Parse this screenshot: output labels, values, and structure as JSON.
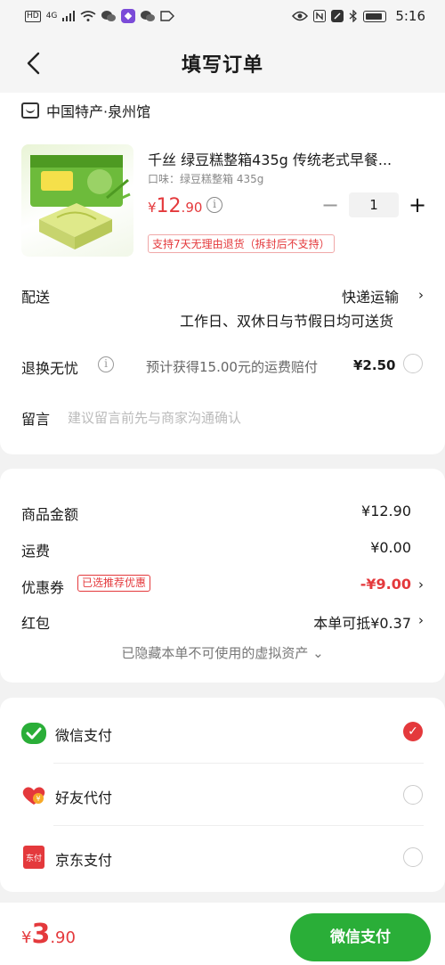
{
  "status_bar": {
    "hd_label": "HD",
    "signal_label": "4G",
    "time": "5:16"
  },
  "header": {
    "title": "填写订单"
  },
  "shop": {
    "name": "中国特产·泉州馆"
  },
  "product": {
    "name": "千丝 绿豆糕整箱435g 传统老式早餐...",
    "spec": "口味：绿豆糕整箱 435g",
    "price_symbol": "¥",
    "price_main": "12",
    "price_decimal": ".90",
    "quantity": "1",
    "minus_label": "−",
    "plus_label": "+",
    "return_policy": "支持7天无理由退货（拆封后不支持）"
  },
  "delivery": {
    "label": "配送",
    "method": "快递运输",
    "note": "工作日、双休日与节假日均可送货"
  },
  "return_insurance": {
    "label": "退换无忧",
    "text": "预计获得15.00元的运费赔付",
    "price": "¥2.50"
  },
  "message": {
    "label": "留言",
    "placeholder": "建议留言前先与商家沟通确认"
  },
  "summary": {
    "goods_label": "商品金额",
    "goods_value": "¥12.90",
    "shipping_label": "运费",
    "shipping_value": "¥0.00",
    "coupon_label": "优惠券",
    "coupon_tag": "已选推荐优惠",
    "coupon_value": "-¥9.00",
    "redpacket_label": "红包",
    "redpacket_value": "本单可抵¥0.37",
    "hidden_note": "已隐藏本单不可使用的虚拟资产 ⌄"
  },
  "payment": {
    "methods": [
      {
        "label": "微信支付",
        "selected": true
      },
      {
        "label": "好友代付",
        "selected": false
      },
      {
        "label": "京东支付",
        "selected": false
      }
    ],
    "jd_icon_text": "东付"
  },
  "bottom": {
    "total_symbol": "¥",
    "total_main": "3",
    "total_decimal": ".90",
    "submit_label": "微信支付"
  },
  "colors": {
    "accent": "#e4393c",
    "wechat_green": "#2aae38"
  }
}
